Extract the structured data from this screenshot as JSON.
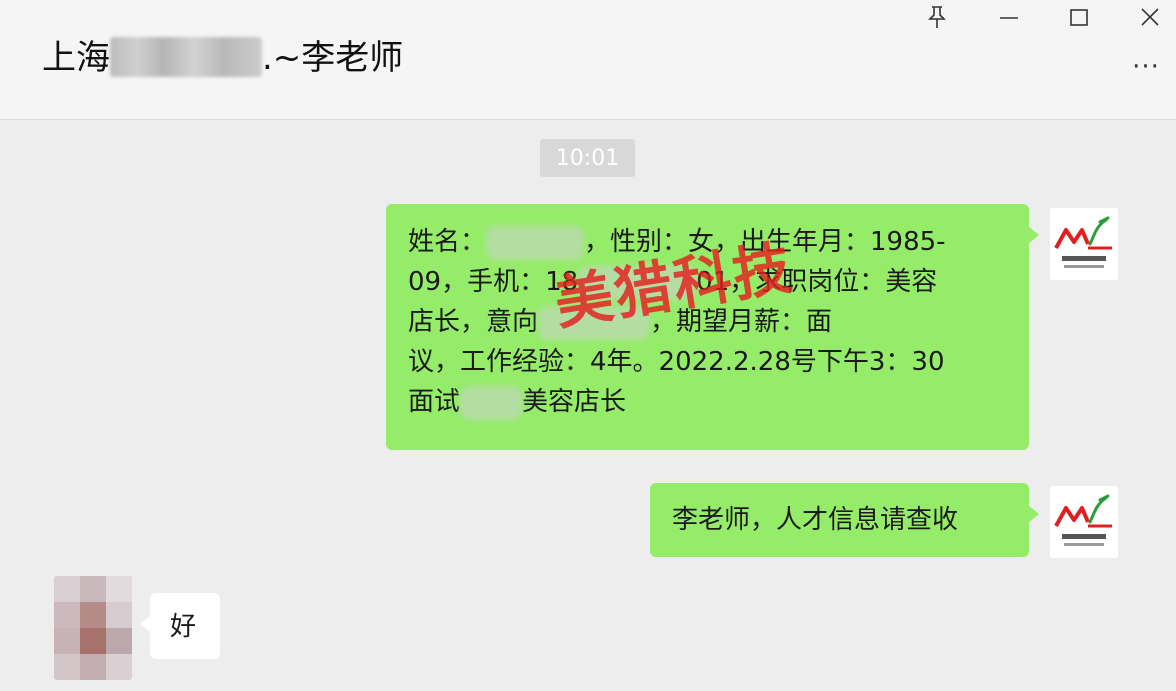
{
  "header": {
    "title_prefix": "上海",
    "title_suffix": ".~李老师",
    "more_label": "···"
  },
  "window_controls": {
    "pin_icon": "pin-icon",
    "minimize_icon": "minimize-icon",
    "maximize_icon": "maximize-icon",
    "close_icon": "close-icon"
  },
  "chat": {
    "timestamp": "10:01",
    "messages": [
      {
        "lines": [
          [
            "姓名：",
            "，性别：女，出生年月：1985-"
          ],
          [
            "09，手机：18",
            "01，求职岗位：美容"
          ],
          [
            "店长，意向",
            "，期望月薪：面"
          ],
          [
            "议，工作经验：4年。2022.2.28号下午3：30"
          ],
          [
            "面试",
            "美容店长"
          ]
        ]
      },
      {
        "text": "李老师，人才信息请查收"
      },
      {
        "text": "好"
      }
    ]
  },
  "watermark": {
    "text": "美猎科技"
  },
  "colors": {
    "outgoing_bubble": "#95ec69",
    "incoming_bubble": "#ffffff",
    "background": "#ededed",
    "header_bg": "#f5f5f5",
    "logo_red": "#e02020",
    "logo_green": "#2a9d3a"
  }
}
